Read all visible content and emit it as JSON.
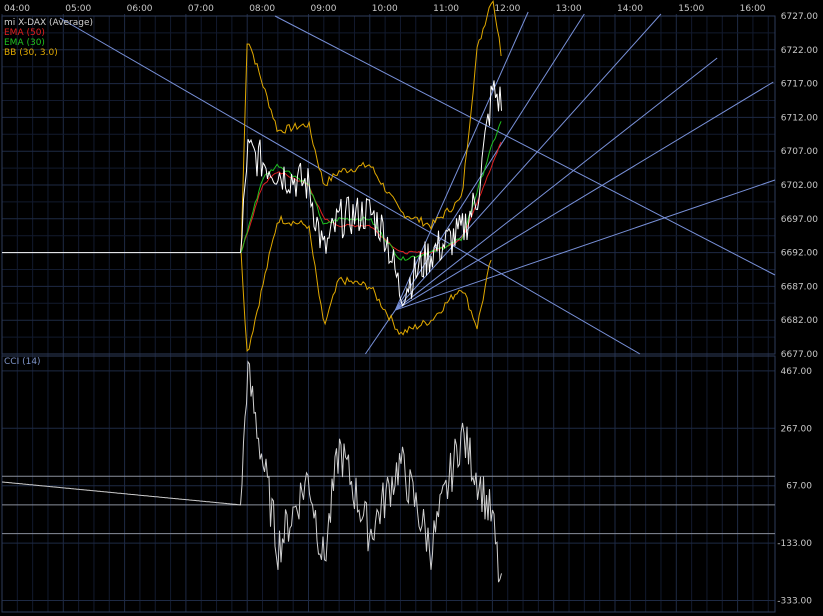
{
  "chart_data": [
    {
      "type": "line",
      "panel": "price",
      "time_axis": [
        "04:00",
        "05:00",
        "06:00",
        "07:00",
        "08:00",
        "09:00",
        "10:00",
        "11:00",
        "12:00",
        "13:00",
        "14:00",
        "15:00",
        "16:00"
      ],
      "ylim": [
        6677,
        6727
      ],
      "y_ticks": [
        "6727.00",
        "6722.00",
        "6717.00",
        "6712.00",
        "6707.00",
        "6702.00",
        "6697.00",
        "6692.00",
        "6687.00",
        "6682.00",
        "6677.00"
      ],
      "legend": [
        "mi X-DAX (Average)",
        "EMA (50)",
        "EMA (30)",
        "BB (30, 3.0)"
      ],
      "legend_placement": "top-left",
      "grid": true,
      "colors": {
        "price": "#ffffff",
        "ema50": "#e02020",
        "ema30": "#20c020",
        "bb": "#e0a800",
        "gann": "#7890d8",
        "grid": "#1e2a44",
        "background": "#000000"
      },
      "series": [
        {
          "name": "mi X-DAX (Average)",
          "x": [
            "04:00",
            "07:54",
            "08:00",
            "08:30",
            "09:00",
            "09:15",
            "09:30",
            "10:00",
            "10:15",
            "10:30",
            "11:00",
            "11:30",
            "11:45",
            "12:00",
            "12:10"
          ],
          "y": [
            6692,
            6692,
            6707,
            6704,
            6702,
            6692,
            6697,
            6698,
            6695,
            6686,
            6692,
            6695,
            6700,
            6716,
            6714
          ]
        },
        {
          "name": "EMA (50)",
          "x": [
            "07:54",
            "08:15",
            "08:30",
            "09:00",
            "09:15",
            "09:30",
            "10:00",
            "10:30",
            "11:00",
            "11:30",
            "12:00",
            "12:10"
          ],
          "y": [
            6692,
            6702,
            6704,
            6702,
            6697,
            6696,
            6696,
            6692,
            6692,
            6694,
            6705,
            6709
          ]
        },
        {
          "name": "EMA (30)",
          "x": [
            "07:54",
            "08:15",
            "08:30",
            "09:00",
            "09:15",
            "09:30",
            "10:00",
            "10:30",
            "11:00",
            "11:30",
            "12:00",
            "12:10"
          ],
          "y": [
            6692,
            6703,
            6705,
            6702,
            6696,
            6697,
            6697,
            6691,
            6692,
            6694,
            6708,
            6712
          ]
        },
        {
          "name": "BB (30, 3.0)",
          "x": [
            "07:54",
            "08:00",
            "08:30",
            "09:00",
            "09:15",
            "09:30",
            "10:00",
            "10:30",
            "11:00",
            "11:30",
            "11:45",
            "12:00",
            "12:10"
          ],
          "y": [
            6692,
            6724,
            6710,
            6711,
            6702,
            6704,
            6705,
            6698,
            6696,
            6700,
            6722,
            6730,
            6720
          ]
        },
        {
          "name": "BB (30, 3.0)",
          "x": [
            "07:54",
            "08:00",
            "08:30",
            "09:00",
            "09:15",
            "09:30",
            "10:00",
            "10:30",
            "11:00",
            "11:30",
            "11:45",
            "12:00"
          ],
          "y": [
            6692,
            6677,
            6697,
            6696,
            6681,
            6688,
            6687,
            6680,
            6682,
            6687,
            6681,
            6692
          ]
        }
      ]
    },
    {
      "type": "line",
      "panel": "indicator",
      "legend": [
        "CCI (14)"
      ],
      "ylim": [
        -373,
        477
      ],
      "y_ticks": [
        "467.00",
        "267.00",
        "67.00",
        "-133.00",
        "-333.00"
      ],
      "reference_levels": [
        100,
        -100
      ],
      "series": [
        {
          "name": "CCI (14)",
          "x": [
            "04:00",
            "07:54",
            "08:00",
            "08:30",
            "09:00",
            "09:15",
            "09:30",
            "10:00",
            "10:30",
            "11:00",
            "11:30",
            "11:45",
            "12:00",
            "12:10"
          ],
          "y": [
            80,
            0,
            470,
            -150,
            100,
            -200,
            200,
            -100,
            150,
            -150,
            250,
            100,
            -50,
            -350
          ]
        }
      ]
    }
  ]
}
